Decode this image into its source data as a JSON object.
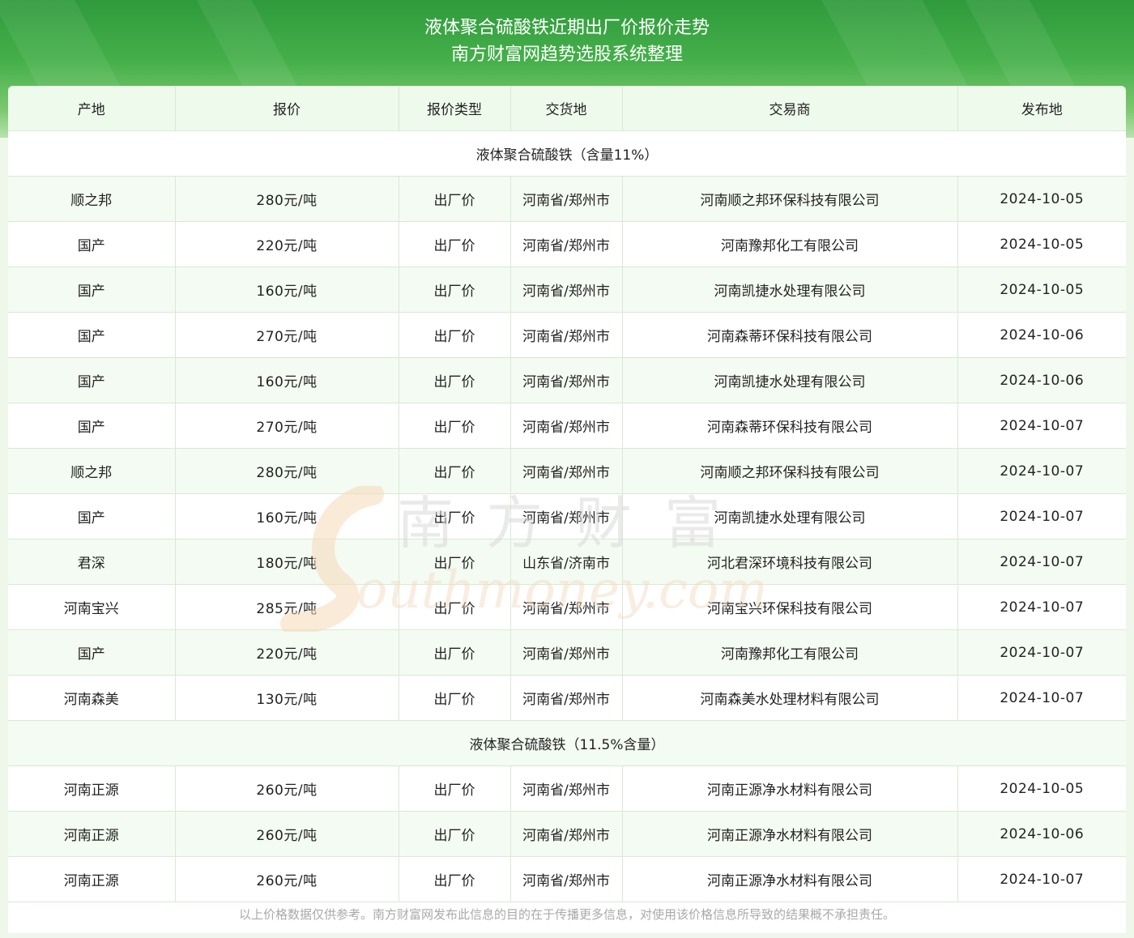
{
  "header": {
    "title_line1": "液体聚合硫酸铁近期出厂价报价走势",
    "title_line2": "南方财富网趋势选股系统整理"
  },
  "table": {
    "columns": [
      "产地",
      "报价",
      "报价类型",
      "交货地",
      "交易商",
      "发布地"
    ],
    "sections": [
      {
        "label": "液体聚合硫酸铁（含量11%）",
        "rows": [
          [
            "顺之邦",
            "280元/吨",
            "出厂价",
            "河南省/郑州市",
            "河南顺之邦环保科技有限公司",
            "2024-10-05"
          ],
          [
            "国产",
            "220元/吨",
            "出厂价",
            "河南省/郑州市",
            "河南豫邦化工有限公司",
            "2024-10-05"
          ],
          [
            "国产",
            "160元/吨",
            "出厂价",
            "河南省/郑州市",
            "河南凯捷水处理有限公司",
            "2024-10-05"
          ],
          [
            "国产",
            "270元/吨",
            "出厂价",
            "河南省/郑州市",
            "河南森蒂环保科技有限公司",
            "2024-10-06"
          ],
          [
            "国产",
            "160元/吨",
            "出厂价",
            "河南省/郑州市",
            "河南凯捷水处理有限公司",
            "2024-10-06"
          ],
          [
            "国产",
            "270元/吨",
            "出厂价",
            "河南省/郑州市",
            "河南森蒂环保科技有限公司",
            "2024-10-07"
          ],
          [
            "顺之邦",
            "280元/吨",
            "出厂价",
            "河南省/郑州市",
            "河南顺之邦环保科技有限公司",
            "2024-10-07"
          ],
          [
            "国产",
            "160元/吨",
            "出厂价",
            "河南省/郑州市",
            "河南凯捷水处理有限公司",
            "2024-10-07"
          ],
          [
            "君深",
            "180元/吨",
            "出厂价",
            "山东省/济南市",
            "河北君深环境科技有限公司",
            "2024-10-07"
          ],
          [
            "河南宝兴",
            "285元/吨",
            "出厂价",
            "河南省/郑州市",
            "河南宝兴环保科技有限公司",
            "2024-10-07"
          ],
          [
            "国产",
            "220元/吨",
            "出厂价",
            "河南省/郑州市",
            "河南豫邦化工有限公司",
            "2024-10-07"
          ],
          [
            "河南森美",
            "130元/吨",
            "出厂价",
            "河南省/郑州市",
            "河南森美水处理材料有限公司",
            "2024-10-07"
          ]
        ]
      },
      {
        "label": "液体聚合硫酸铁（11.5%含量）",
        "rows": [
          [
            "河南正源",
            "260元/吨",
            "出厂价",
            "河南省/郑州市",
            "河南正源净水材料有限公司",
            "2024-10-05"
          ],
          [
            "河南正源",
            "260元/吨",
            "出厂价",
            "河南省/郑州市",
            "河南正源净水材料有限公司",
            "2024-10-06"
          ],
          [
            "河南正源",
            "260元/吨",
            "出厂价",
            "河南省/郑州市",
            "河南正源净水材料有限公司",
            "2024-10-07"
          ]
        ]
      }
    ]
  },
  "watermark": {
    "cn": "南方财富",
    "en": "outhmoney.com"
  },
  "footer": {
    "disclaimer": "以上价格数据仅供参考。南方财富网发布此信息的目的在于传播更多信息，对使用该价格信息所导致的结果概不承担责任。"
  },
  "colors": {
    "banner_top": "#2f9a3c",
    "header_row": "#eefaec",
    "alt_row": "#f4fbf2",
    "border": "#d7ead2"
  }
}
